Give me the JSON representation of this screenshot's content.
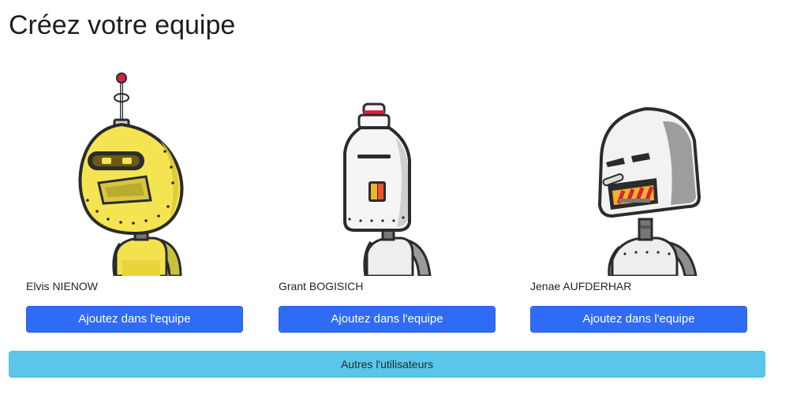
{
  "page": {
    "title": "Créez votre equipe"
  },
  "robots": [
    {
      "name": "Elvis NIENOW",
      "button_label": "Ajoutez dans l'equipe",
      "avatar_icon": "yellow-robot-avatar",
      "color": "#f4e452"
    },
    {
      "name": "Grant BOGISICH",
      "button_label": "Ajoutez dans l'equipe",
      "avatar_icon": "white-bottle-robot-avatar",
      "color": "#f2f2f2"
    },
    {
      "name": "Jenae AUFDERHAR",
      "button_label": "Ajoutez dans l'equipe",
      "avatar_icon": "grey-helmet-robot-avatar",
      "color": "#e8e8e8"
    }
  ],
  "footer": {
    "more_users_label": "Autres l'utilisateurs"
  },
  "colors": {
    "primary_button": "#2f6cf6",
    "info_button": "#5bc6ea"
  }
}
